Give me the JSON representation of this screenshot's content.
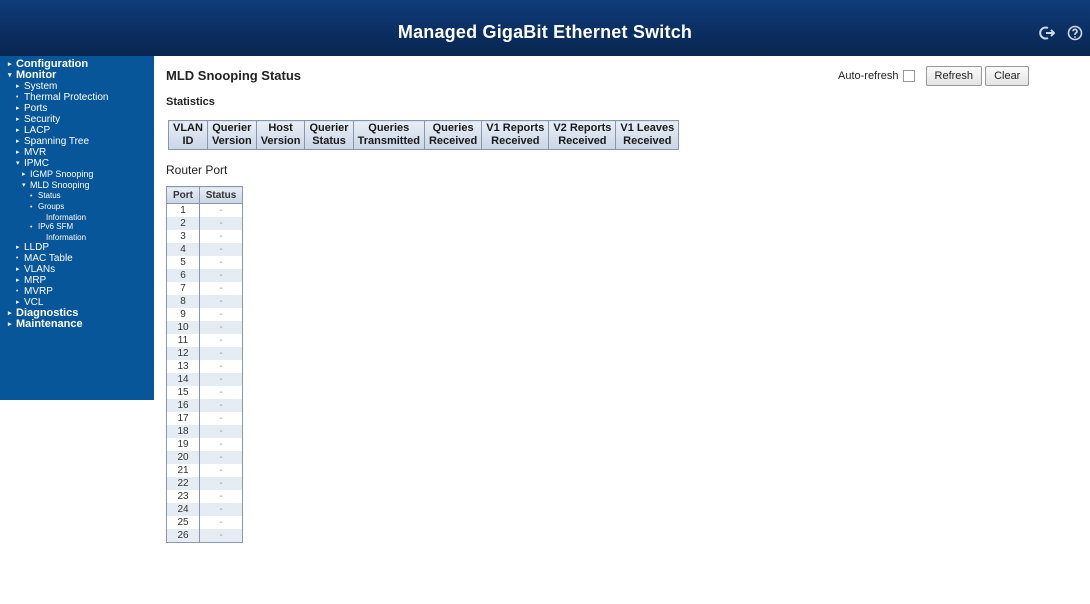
{
  "header": {
    "title": "Managed GigaBit Ethernet Switch",
    "icons": [
      "logout-icon",
      "help-icon"
    ]
  },
  "sidebar": {
    "items": [
      {
        "label": "Configuration",
        "level": 0,
        "arrow": "▸"
      },
      {
        "label": "Monitor",
        "level": 0,
        "arrow": "▾"
      },
      {
        "label": "System",
        "level": 1,
        "arrow": "▸"
      },
      {
        "label": "Thermal Protection",
        "level": 1,
        "arrow": "•"
      },
      {
        "label": "Ports",
        "level": 1,
        "arrow": "▸"
      },
      {
        "label": "Security",
        "level": 1,
        "arrow": "▸"
      },
      {
        "label": "LACP",
        "level": 1,
        "arrow": "▸"
      },
      {
        "label": "Spanning Tree",
        "level": 1,
        "arrow": "▸"
      },
      {
        "label": "MVR",
        "level": 1,
        "arrow": "▸"
      },
      {
        "label": "IPMC",
        "level": 1,
        "arrow": "▾"
      },
      {
        "label": "IGMP Snooping",
        "level": 2,
        "arrow": "▸"
      },
      {
        "label": "MLD Snooping",
        "level": 2,
        "arrow": "▾"
      },
      {
        "label": "Status",
        "level": 3,
        "arrow": "•"
      },
      {
        "label": "Groups",
        "level": 3,
        "arrow": "•"
      },
      {
        "label": "Information",
        "level": 4,
        "arrow": ""
      },
      {
        "label": "IPv6 SFM",
        "level": 3,
        "arrow": "•"
      },
      {
        "label": "Information",
        "level": 4,
        "arrow": ""
      },
      {
        "label": "LLDP",
        "level": 1,
        "arrow": "▸"
      },
      {
        "label": "MAC Table",
        "level": 1,
        "arrow": "•"
      },
      {
        "label": "VLANs",
        "level": 1,
        "arrow": "▸"
      },
      {
        "label": "MRP",
        "level": 1,
        "arrow": "▸"
      },
      {
        "label": "MVRP",
        "level": 1,
        "arrow": "•"
      },
      {
        "label": "VCL",
        "level": 1,
        "arrow": "▸"
      },
      {
        "label": "Diagnostics",
        "level": 0,
        "arrow": "▸"
      },
      {
        "label": "Maintenance",
        "level": 0,
        "arrow": "▸"
      }
    ]
  },
  "page": {
    "title": "MLD Snooping Status",
    "statistics_heading": "Statistics",
    "router_port_heading": "Router Port"
  },
  "controls": {
    "auto_refresh_label": "Auto-refresh",
    "auto_refresh_checked": false,
    "refresh_label": "Refresh",
    "clear_label": "Clear"
  },
  "statistics_table": {
    "columns": [
      [
        "VLAN",
        "ID"
      ],
      [
        "Querier",
        "Version"
      ],
      [
        "Host",
        "Version"
      ],
      [
        "Querier",
        "Status"
      ],
      [
        "Queries",
        "Transmitted"
      ],
      [
        "Queries",
        "Received"
      ],
      [
        "V1 Reports",
        "Received"
      ],
      [
        "V2 Reports",
        "Received"
      ],
      [
        "V1 Leaves",
        "Received"
      ]
    ]
  },
  "router_port_table": {
    "headers": [
      "Port",
      "Status"
    ],
    "rows": [
      [
        "1",
        "-"
      ],
      [
        "2",
        "-"
      ],
      [
        "3",
        "-"
      ],
      [
        "4",
        "-"
      ],
      [
        "5",
        "-"
      ],
      [
        "6",
        "-"
      ],
      [
        "7",
        "-"
      ],
      [
        "8",
        "-"
      ],
      [
        "9",
        "-"
      ],
      [
        "10",
        "-"
      ],
      [
        "11",
        "-"
      ],
      [
        "12",
        "-"
      ],
      [
        "13",
        "-"
      ],
      [
        "14",
        "-"
      ],
      [
        "15",
        "-"
      ],
      [
        "16",
        "-"
      ],
      [
        "17",
        "-"
      ],
      [
        "18",
        "-"
      ],
      [
        "19",
        "-"
      ],
      [
        "20",
        "-"
      ],
      [
        "21",
        "-"
      ],
      [
        "22",
        "-"
      ],
      [
        "23",
        "-"
      ],
      [
        "24",
        "-"
      ],
      [
        "25",
        "-"
      ],
      [
        "26",
        "-"
      ]
    ]
  },
  "colors": {
    "header_bg": "#0b2f63",
    "sidebar_bg": "#07569a",
    "row_alt": "#e6ecf4"
  }
}
